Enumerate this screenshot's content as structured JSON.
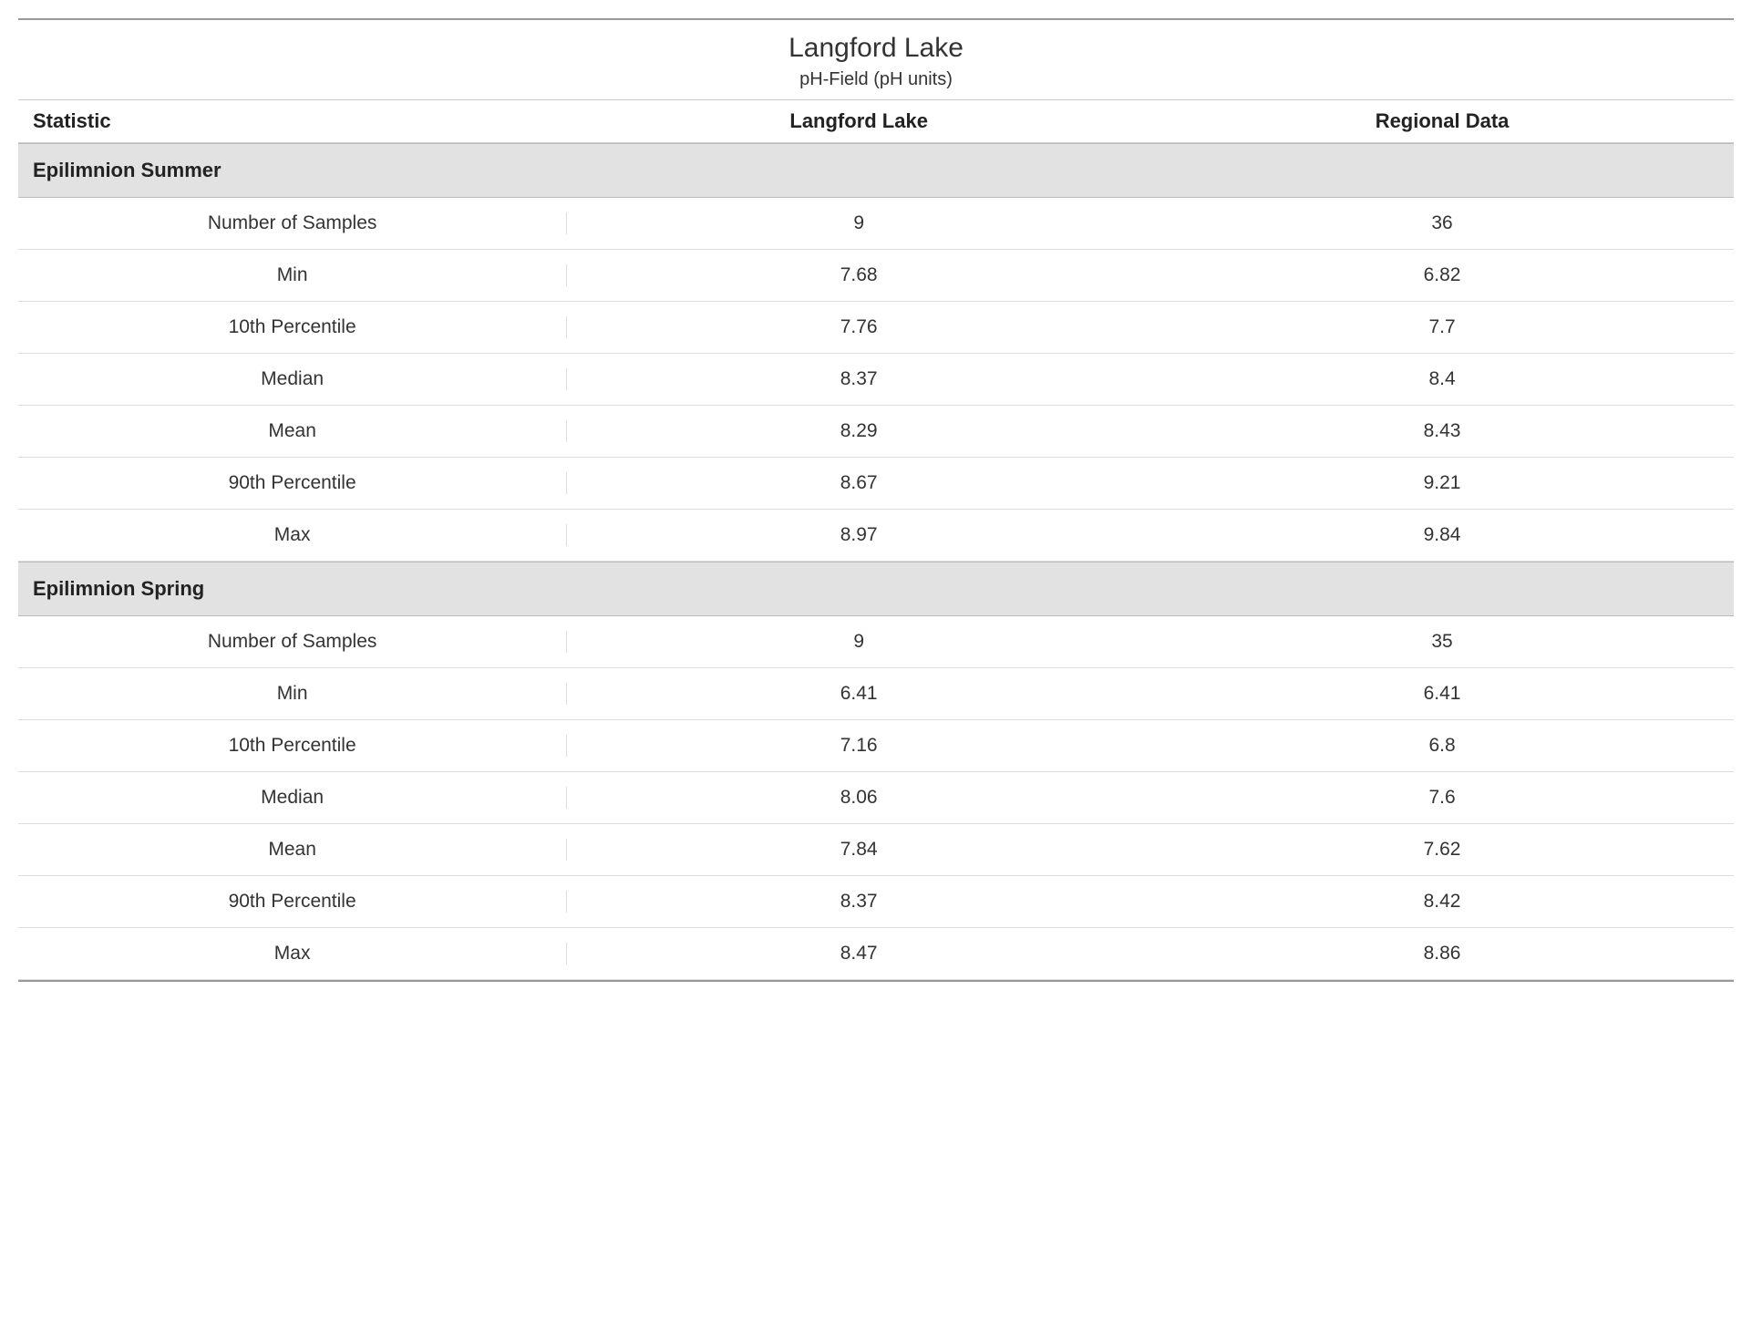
{
  "title": "Langford Lake",
  "subtitle": "pH-Field (pH units)",
  "columns": {
    "stat": "Statistic",
    "col1": "Langford Lake",
    "col2": "Regional Data"
  },
  "groups": [
    {
      "name": "Epilimnion Summer",
      "rows": [
        {
          "stat": "Number of Samples",
          "v1": "9",
          "v2": "36"
        },
        {
          "stat": "Min",
          "v1": "7.68",
          "v2": "6.82"
        },
        {
          "stat": "10th Percentile",
          "v1": "7.76",
          "v2": "7.7"
        },
        {
          "stat": "Median",
          "v1": "8.37",
          "v2": "8.4"
        },
        {
          "stat": "Mean",
          "v1": "8.29",
          "v2": "8.43"
        },
        {
          "stat": "90th Percentile",
          "v1": "8.67",
          "v2": "9.21"
        },
        {
          "stat": "Max",
          "v1": "8.97",
          "v2": "9.84"
        }
      ]
    },
    {
      "name": "Epilimnion Spring",
      "rows": [
        {
          "stat": "Number of Samples",
          "v1": "9",
          "v2": "35"
        },
        {
          "stat": "Min",
          "v1": "6.41",
          "v2": "6.41"
        },
        {
          "stat": "10th Percentile",
          "v1": "7.16",
          "v2": "6.8"
        },
        {
          "stat": "Median",
          "v1": "8.06",
          "v2": "7.6"
        },
        {
          "stat": "Mean",
          "v1": "7.84",
          "v2": "7.62"
        },
        {
          "stat": "90th Percentile",
          "v1": "8.37",
          "v2": "8.42"
        },
        {
          "stat": "Max",
          "v1": "8.47",
          "v2": "8.86"
        }
      ]
    }
  ]
}
